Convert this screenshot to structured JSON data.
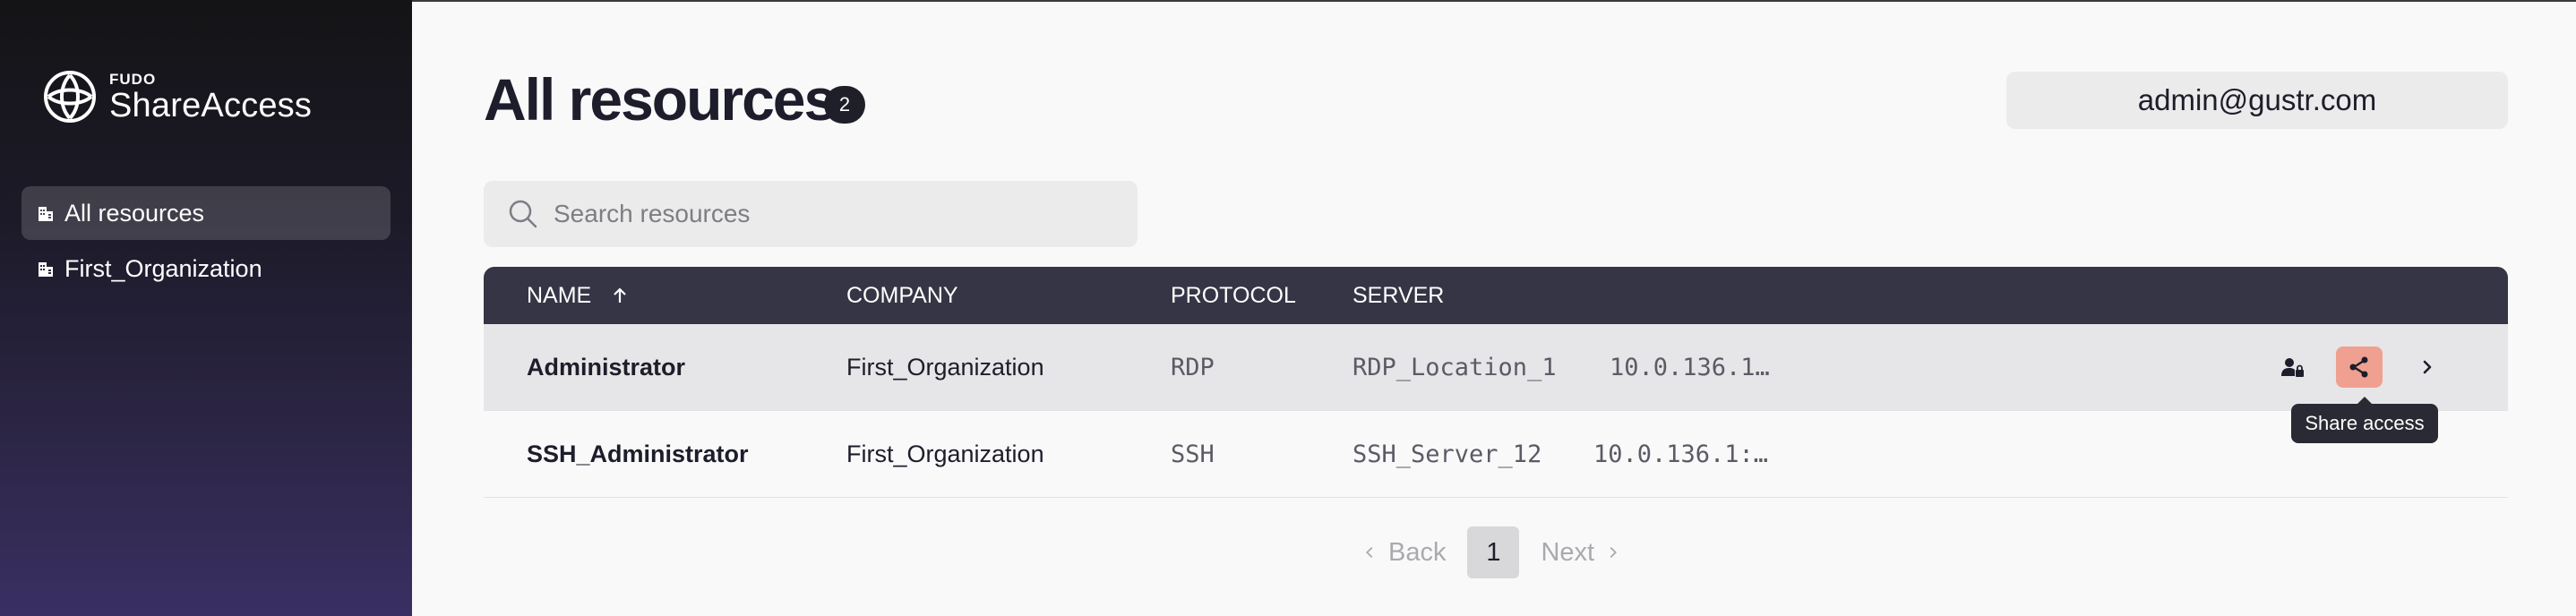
{
  "app": {
    "logo_small": "FUDO",
    "logo_name": "ShareAccess"
  },
  "sidebar": {
    "items": [
      {
        "label": "All resources",
        "icon": "building-icon",
        "active": true
      },
      {
        "label": "First_Organization",
        "icon": "building-icon",
        "active": false
      }
    ]
  },
  "header": {
    "title": "All resources",
    "count": "2",
    "user": "admin@gustr.com"
  },
  "search": {
    "placeholder": "Search resources",
    "value": ""
  },
  "table": {
    "columns": [
      "NAME",
      "COMPANY",
      "PROTOCOL",
      "SERVER"
    ],
    "sort": {
      "column": "NAME",
      "direction": "ascending"
    },
    "rows": [
      {
        "name": "Administrator",
        "company": "First_Organization",
        "protocol": "RDP",
        "server": "RDP_Location_1",
        "address": "10.0.136.1…"
      },
      {
        "name": "SSH_Administrator",
        "company": "First_Organization",
        "protocol": "SSH",
        "server": "SSH_Server_12",
        "address": "10.0.136.1:…"
      }
    ],
    "row_actions": {
      "tooltip": "Share access"
    }
  },
  "pagination": {
    "back": "Back",
    "next": "Next",
    "current": "1"
  },
  "colors": {
    "header_bg": "#353546",
    "share_button": "#f0a090",
    "sidebar_bottom": "#3a2f63"
  }
}
